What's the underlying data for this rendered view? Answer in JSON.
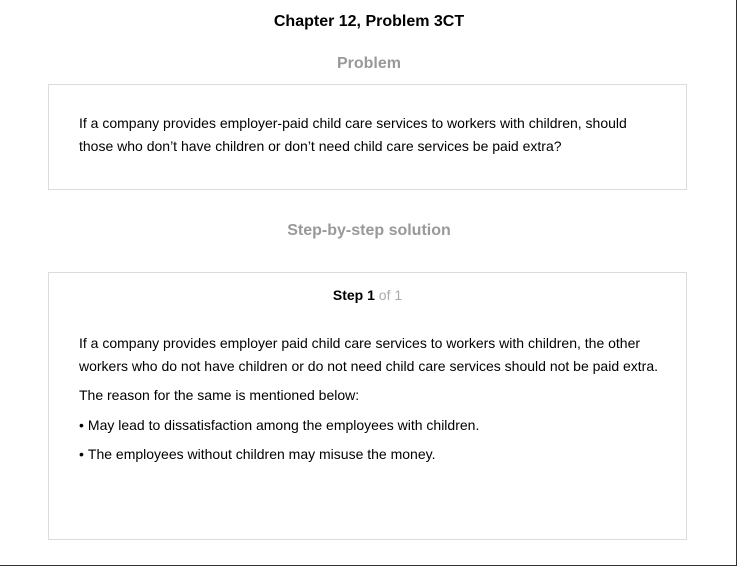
{
  "header": {
    "chapter_title": "Chapter 12, Problem 3CT"
  },
  "problem": {
    "heading": "Problem",
    "text": "If a company provides employer-paid child care services to workers with children, should those who don’t have children or don’t need child care services be paid extra?"
  },
  "solution": {
    "heading": "Step-by-step solution",
    "step_word": "Step",
    "step_number": "1",
    "step_of": "of 1",
    "paragraph": "If a company provides employer paid child care services to workers with children, the other workers who do not have children or do not need child care services should not be paid extra.",
    "reason_intro": "The reason for the same is mentioned below:",
    "bullet_mark": "•",
    "bullets": [
      "May lead to dissatisfaction among the employees with children.",
      "The employees without children may misuse the money."
    ]
  }
}
